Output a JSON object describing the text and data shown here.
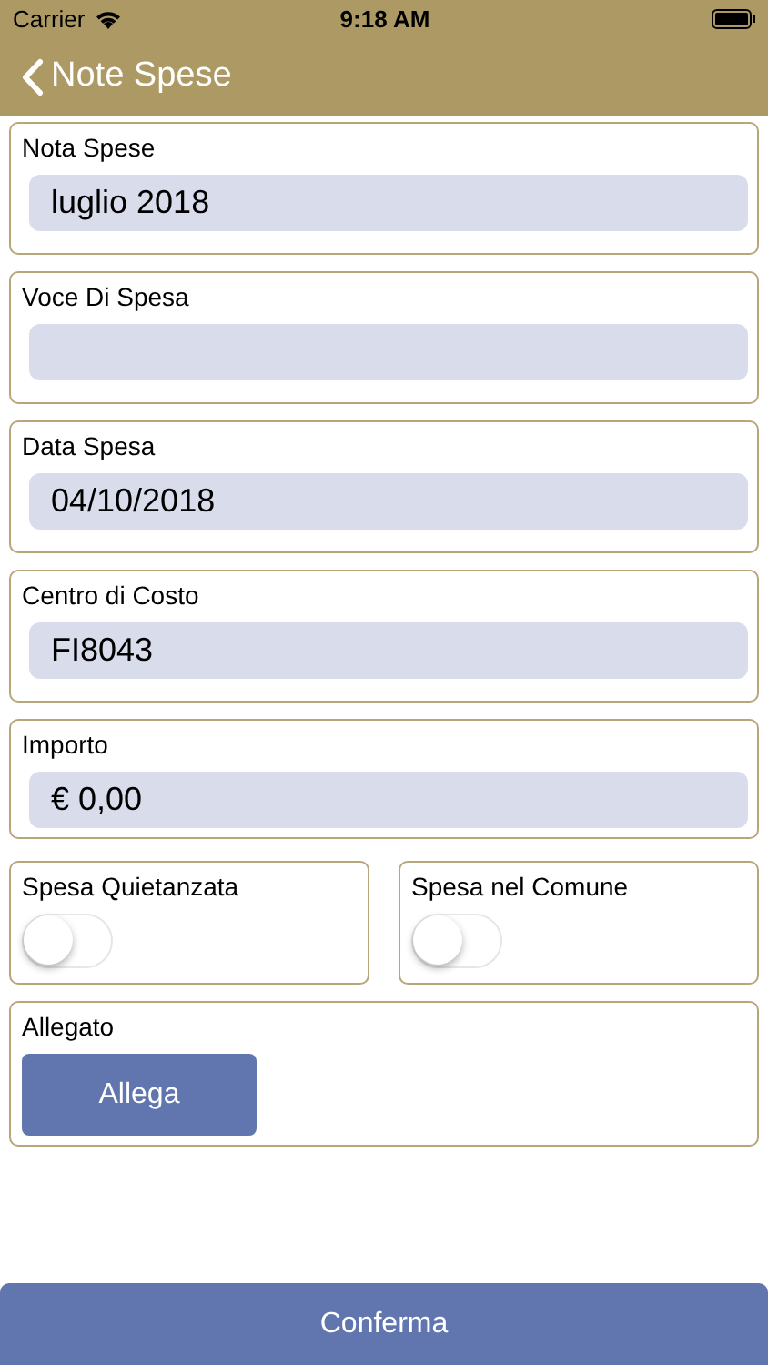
{
  "status_bar": {
    "carrier": "Carrier",
    "time": "9:18 AM"
  },
  "nav": {
    "back_label": "Note Spese"
  },
  "fields": [
    {
      "label": "Nota Spese",
      "value": "luglio 2018"
    },
    {
      "label": "Voce Di Spesa"
    },
    {
      "label": "Data Spesa",
      "value": "04/10/2018"
    },
    {
      "label": "Centro di Costo",
      "value": "FI8043"
    },
    {
      "label": "Importo",
      "value": "€ 0,00"
    }
  ],
  "toggles": [
    {
      "label": "Spesa Quietanzata",
      "on": false
    },
    {
      "label": "Spesa nel Comune",
      "on": false
    }
  ],
  "attachment": {
    "label": "Allegato",
    "button": "Allega"
  },
  "confirm_button": "Conferma"
}
